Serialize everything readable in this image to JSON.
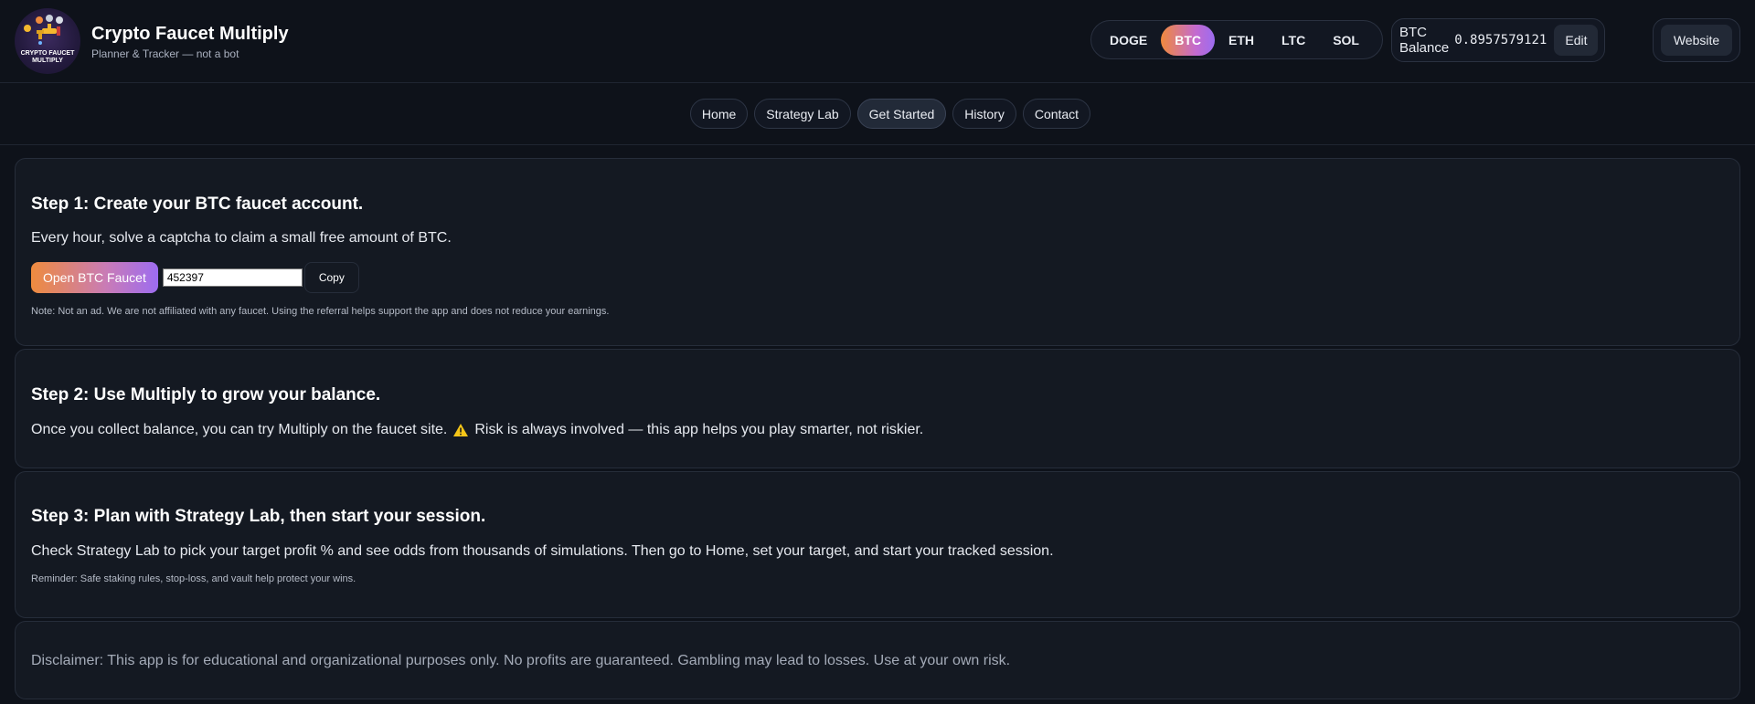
{
  "header": {
    "logo_text": "CRYPTO FAUCET MULTIPLY",
    "title": "Crypto Faucet Multiply",
    "subtitle": "Planner & Tracker — not a bot",
    "coins": [
      "DOGE",
      "BTC",
      "ETH",
      "LTC",
      "SOL"
    ],
    "active_coin": "BTC",
    "balance_label": "BTC Balance",
    "balance_value": "0.8957579121",
    "edit_label": "Edit",
    "website_label": "Website"
  },
  "nav": {
    "items": [
      "Home",
      "Strategy Lab",
      "Get Started",
      "History",
      "Contact"
    ],
    "active": "Get Started"
  },
  "step1": {
    "title": "Step 1: Create your BTC faucet account.",
    "body": "Every hour, solve a captcha to claim a small free amount of BTC.",
    "faucet_button": "Open BTC Faucet",
    "referral_code": "452397",
    "copy_label": "Copy",
    "note": "Note: Not an ad. We are not affiliated with any faucet. Using the referral helps support the app and does not reduce your earnings."
  },
  "step2": {
    "title": "Step 2: Use Multiply to grow your balance.",
    "body_before": "Once you collect balance, you can try Multiply on the faucet site.",
    "warning_icon": "warning-icon",
    "body_after": "Risk is always involved — this app helps you play smarter, not riskier."
  },
  "step3": {
    "title": "Step 3: Plan with Strategy Lab, then start your session.",
    "body": "Check Strategy Lab to pick your target profit % and see odds from thousands of simulations. Then go to Home, set your target, and start your tracked session.",
    "note": "Reminder: Safe staking rules, stop-loss, and vault help protect your wins."
  },
  "disclaimer": "Disclaimer: This app is for educational and organizational purposes only. No profits are guaranteed. Gambling may lead to losses. Use at your own risk.",
  "colors": {
    "background": "#0e121a",
    "card": "#141922",
    "accent_start": "#f08a3c",
    "accent_end": "#9b6cf0",
    "warning": "#f5c518"
  }
}
